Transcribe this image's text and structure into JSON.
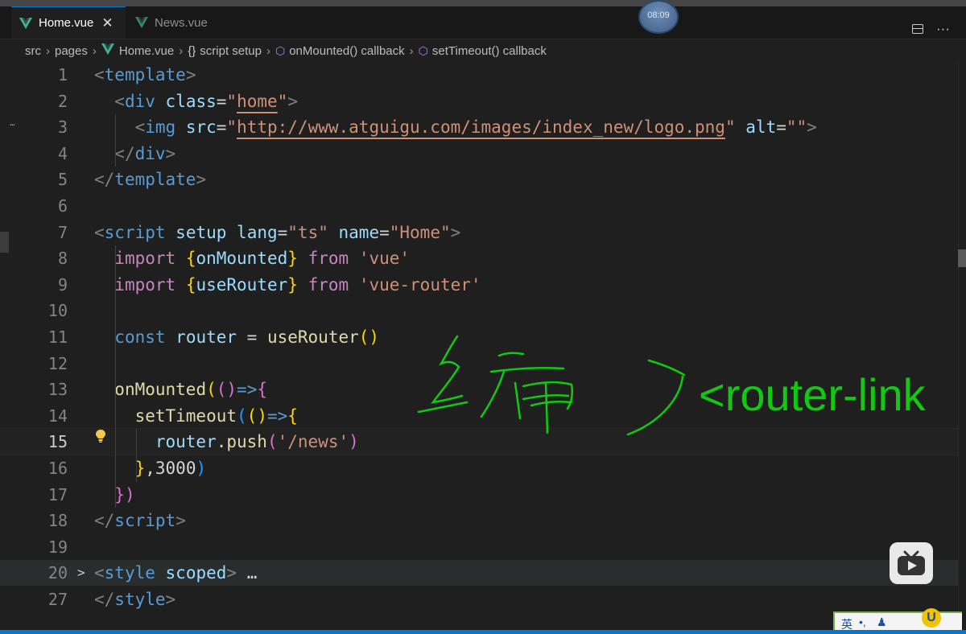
{
  "colors": {
    "editor_bg": "#1f1f1f",
    "accent": "#0078d4",
    "annotation_green": "#12c912"
  },
  "tabs": [
    {
      "label": "Home.vue",
      "icon": "vue-logo-icon",
      "active": true
    },
    {
      "label": "News.vue",
      "icon": "vue-logo-icon",
      "active": false
    }
  ],
  "overlay_clock": "08:09",
  "breadcrumb": [
    {
      "label": "src"
    },
    {
      "label": "pages"
    },
    {
      "label": "Home.vue",
      "icon": "vue-logo-icon"
    },
    {
      "label": "script setup",
      "icon": "braces-icon"
    },
    {
      "label": "onMounted() callback",
      "icon": "method-cube-icon"
    },
    {
      "label": "setTimeout() callback",
      "icon": "method-cube-icon"
    }
  ],
  "editor": {
    "current_line": "15",
    "lines": [
      {
        "n": "1",
        "tokens": [
          [
            "t-gray",
            "<"
          ],
          [
            "t-tag",
            "template"
          ],
          [
            "t-gray",
            ">"
          ]
        ]
      },
      {
        "n": "2",
        "tokens": [
          [
            "t-white",
            "  "
          ],
          [
            "t-gray",
            "<"
          ],
          [
            "t-tag",
            "div"
          ],
          [
            "t-white",
            " "
          ],
          [
            "t-attr",
            "class"
          ],
          [
            "t-white",
            "="
          ],
          [
            "t-str",
            "\""
          ],
          [
            "t-str underline",
            "home"
          ],
          [
            "t-str",
            "\""
          ],
          [
            "t-gray",
            ">"
          ]
        ]
      },
      {
        "n": "3",
        "tokens": [
          [
            "t-white",
            "    "
          ],
          [
            "t-gray",
            "<"
          ],
          [
            "t-tag",
            "img"
          ],
          [
            "t-white",
            " "
          ],
          [
            "t-attr",
            "src"
          ],
          [
            "t-white",
            "="
          ],
          [
            "t-str",
            "\""
          ],
          [
            "t-str underline",
            "http://www.atguigu.com/images/index_new/logo.png"
          ],
          [
            "t-str",
            "\""
          ],
          [
            "t-white",
            " "
          ],
          [
            "t-attr",
            "alt"
          ],
          [
            "t-white",
            "="
          ],
          [
            "t-str",
            "\"\""
          ],
          [
            "t-gray",
            ">"
          ]
        ]
      },
      {
        "n": "4",
        "tokens": [
          [
            "t-white",
            "  "
          ],
          [
            "t-gray",
            "</"
          ],
          [
            "t-tag",
            "div"
          ],
          [
            "t-gray",
            ">"
          ]
        ]
      },
      {
        "n": "5",
        "tokens": [
          [
            "t-gray",
            "</"
          ],
          [
            "t-tag",
            "template"
          ],
          [
            "t-gray",
            ">"
          ]
        ]
      },
      {
        "n": "6",
        "tokens": []
      },
      {
        "n": "7",
        "tokens": [
          [
            "t-gray",
            "<"
          ],
          [
            "t-tag",
            "script"
          ],
          [
            "t-white",
            " "
          ],
          [
            "t-attr",
            "setup"
          ],
          [
            "t-white",
            " "
          ],
          [
            "t-attr",
            "lang"
          ],
          [
            "t-white",
            "="
          ],
          [
            "t-str",
            "\"ts\""
          ],
          [
            "t-white",
            " "
          ],
          [
            "t-attr",
            "name"
          ],
          [
            "t-white",
            "="
          ],
          [
            "t-str",
            "\"Home\""
          ],
          [
            "t-gray",
            ">"
          ]
        ]
      },
      {
        "n": "8",
        "tokens": [
          [
            "t-white",
            "  "
          ],
          [
            "t-kw",
            "import"
          ],
          [
            "t-white",
            " "
          ],
          [
            "t-p1",
            "{"
          ],
          [
            "t-var",
            "onMounted"
          ],
          [
            "t-p1",
            "}"
          ],
          [
            "t-white",
            " "
          ],
          [
            "t-kw",
            "from"
          ],
          [
            "t-white",
            " "
          ],
          [
            "t-str",
            "'vue'"
          ]
        ]
      },
      {
        "n": "9",
        "tokens": [
          [
            "t-white",
            "  "
          ],
          [
            "t-kw",
            "import"
          ],
          [
            "t-white",
            " "
          ],
          [
            "t-p1",
            "{"
          ],
          [
            "t-var",
            "useRouter"
          ],
          [
            "t-p1",
            "}"
          ],
          [
            "t-white",
            " "
          ],
          [
            "t-kw",
            "from"
          ],
          [
            "t-white",
            " "
          ],
          [
            "t-str",
            "'vue-router'"
          ]
        ]
      },
      {
        "n": "10",
        "tokens": []
      },
      {
        "n": "11",
        "tokens": [
          [
            "t-white",
            "  "
          ],
          [
            "t-const",
            "const"
          ],
          [
            "t-white",
            " "
          ],
          [
            "t-var",
            "router"
          ],
          [
            "t-white",
            " = "
          ],
          [
            "t-fn",
            "useRouter"
          ],
          [
            "t-p1",
            "()"
          ]
        ]
      },
      {
        "n": "12",
        "tokens": []
      },
      {
        "n": "13",
        "tokens": [
          [
            "t-white",
            "  "
          ],
          [
            "t-fn",
            "onMounted"
          ],
          [
            "t-p1",
            "("
          ],
          [
            "t-p2",
            "()"
          ],
          [
            "t-const",
            "=>"
          ],
          [
            "t-p2",
            "{"
          ]
        ]
      },
      {
        "n": "14",
        "tokens": [
          [
            "t-white",
            "    "
          ],
          [
            "t-fn",
            "setTimeout"
          ],
          [
            "t-p3",
            "("
          ],
          [
            "t-p1",
            "()"
          ],
          [
            "t-const",
            "=>"
          ],
          [
            "t-p1",
            "{"
          ]
        ]
      },
      {
        "n": "15",
        "tokens": [
          [
            "t-white",
            "      "
          ],
          [
            "t-var",
            "router"
          ],
          [
            "t-white",
            "."
          ],
          [
            "t-fn",
            "push"
          ],
          [
            "t-p2",
            "("
          ],
          [
            "t-str",
            "'/news'"
          ],
          [
            "t-p2",
            ")"
          ]
        ]
      },
      {
        "n": "16",
        "tokens": [
          [
            "t-white",
            "    "
          ],
          [
            "t-p1",
            "}"
          ],
          [
            "t-white",
            ","
          ],
          [
            "t-white",
            "3000"
          ],
          [
            "t-p3",
            ")"
          ]
        ]
      },
      {
        "n": "17",
        "tokens": [
          [
            "t-white",
            "  "
          ],
          [
            "t-p2",
            "})"
          ]
        ]
      },
      {
        "n": "18",
        "tokens": [
          [
            "t-gray",
            "</"
          ],
          [
            "t-tag",
            "script"
          ],
          [
            "t-gray",
            ">"
          ]
        ]
      },
      {
        "n": "19",
        "tokens": []
      },
      {
        "n": "20",
        "fold": ">",
        "tokens": [
          [
            "t-gray",
            "<"
          ],
          [
            "t-tag",
            "style"
          ],
          [
            "t-white",
            " "
          ],
          [
            "t-attr",
            "scoped"
          ],
          [
            "t-gray",
            ">"
          ],
          [
            "t-white",
            " …"
          ]
        ]
      },
      {
        "n": "27",
        "tokens": [
          [
            "t-gray",
            "</"
          ],
          [
            "t-tag",
            "style"
          ],
          [
            "t-gray",
            ">"
          ]
        ]
      }
    ]
  },
  "annotation": {
    "handwriting": "编",
    "typed_text": "<router-link"
  },
  "ime": {
    "label": "英"
  }
}
